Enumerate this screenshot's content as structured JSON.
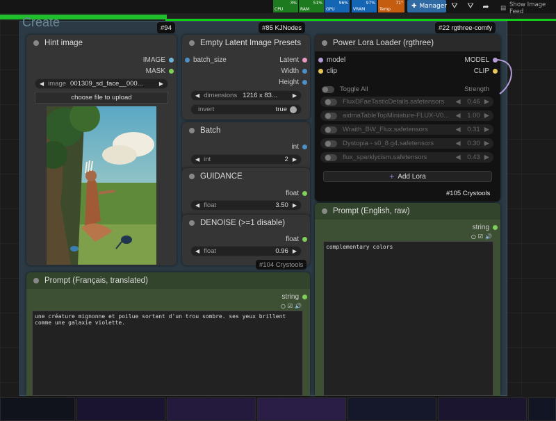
{
  "monitors": [
    {
      "label": "CPU",
      "pct": "3%",
      "color": "#1e7a1e"
    },
    {
      "label": "RAM",
      "pct": "51%",
      "color": "#1e7a1e"
    },
    {
      "label": "GPU",
      "pct": "96%",
      "color": "#1565b5"
    },
    {
      "label": "VRAM",
      "pct": "97%",
      "color": "#1565b5"
    },
    {
      "label": "Temp",
      "pct": "71°",
      "color": "#c45d10"
    }
  ],
  "topbar": {
    "manager_label": "Manager",
    "show_feed_label": "Show Image Feed",
    "progress_fraction": 0.3
  },
  "group": {
    "title": "Create"
  },
  "badges": {
    "hint": "#94",
    "latent": "#85 KJNodes",
    "lora": "#22 rgthree-comfy",
    "crystools1": "#105 Crystools",
    "crystools2": "#104 Crystools"
  },
  "hint_image": {
    "title": "Hint image",
    "out1": "IMAGE",
    "out2": "MASK",
    "image_name": "image",
    "image_value": "001309_sd_face__000...",
    "upload_label": "choose file to upload"
  },
  "latent": {
    "title": "Empty Latent Image Presets",
    "in1": "batch_size",
    "out1": "Latent",
    "out2": "Width",
    "out3": "Height",
    "dim_name": "dimensions",
    "dim_value": "1216 x 83...",
    "invert_name": "invert",
    "invert_value": "true"
  },
  "batch": {
    "title": "Batch",
    "out": "int",
    "name": "int",
    "value": "2"
  },
  "guidance": {
    "title": "GUIDANCE",
    "out": "float",
    "name": "float",
    "value": "3.50"
  },
  "denoise": {
    "title": "DENOISE (>=1 disable)",
    "out": "float",
    "name": "float",
    "value": "0.96"
  },
  "lora": {
    "title": "Power Lora Loader (rgthree)",
    "in1": "model",
    "in2": "clip",
    "out1": "MODEL",
    "out2": "CLIP",
    "toggle_all": "Toggle All",
    "strength_label": "Strength",
    "rows": [
      {
        "name": "FluxDFaeTasticDetails.safetensors",
        "value": "0.46"
      },
      {
        "name": "aidmaTableTopMiniature-FLUX-V0...",
        "value": "1.00"
      },
      {
        "name": "Wraith_BW_Flux.safetensors",
        "value": "0.31"
      },
      {
        "name": "Dystopia - s0_8 g4.safetensors",
        "value": "0.30"
      },
      {
        "name": "flux_sparklycism.safetensors",
        "value": "0.43"
      }
    ],
    "add_label": "Add Lora"
  },
  "prompt_en": {
    "title": "Prompt (English, raw)",
    "out": "string",
    "text": "complementary colors"
  },
  "prompt_fr": {
    "title": "Prompt (Français, translated)",
    "out": "string",
    "text": "une créature mignonne et poilue sortant d'un trou sombre. ses yeux brillent comme une galaxie violette."
  },
  "colors": {
    "node_bg": "#353535",
    "group_bg": "#2b3a45",
    "green_node": "#33442c",
    "accent_green": "#1fbf2c"
  }
}
